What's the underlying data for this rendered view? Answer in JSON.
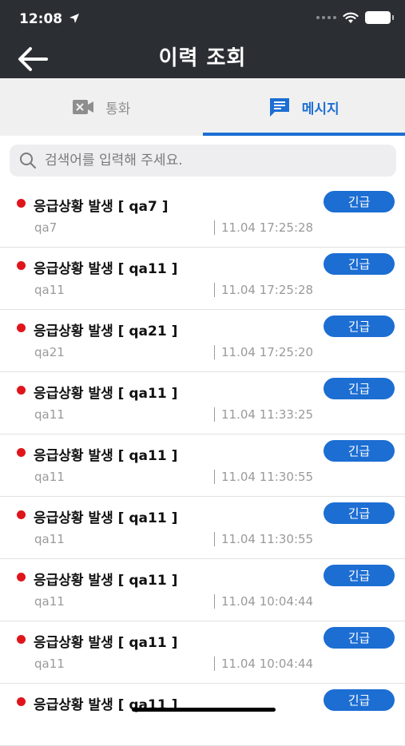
{
  "status_bar": {
    "time": "12:08"
  },
  "header": {
    "title": "이력 조회"
  },
  "tabs": [
    {
      "label": "통화",
      "icon": "video-camera-icon",
      "active": false
    },
    {
      "label": "메시지",
      "icon": "message-icon",
      "active": true
    }
  ],
  "search": {
    "placeholder": "검색어를 입력해 주세요."
  },
  "colors": {
    "header_bg": "#2b2f33",
    "accent": "#1c6ed3",
    "alert_dot": "#e0151b"
  },
  "messages": [
    {
      "title": "응급상황 발생 [ qa7 ]",
      "sender": "qa7",
      "time": "11.04 17:25:28",
      "badge": "긴급"
    },
    {
      "title": "응급상황 발생 [ qa11 ]",
      "sender": "qa11",
      "time": "11.04 17:25:28",
      "badge": "긴급"
    },
    {
      "title": "응급상황 발생 [ qa21 ]",
      "sender": "qa21",
      "time": "11.04 17:25:20",
      "badge": "긴급"
    },
    {
      "title": "응급상황 발생 [ qa11 ]",
      "sender": "qa11",
      "time": "11.04 11:33:25",
      "badge": "긴급"
    },
    {
      "title": "응급상황 발생 [ qa11 ]",
      "sender": "qa11",
      "time": "11.04 11:30:55",
      "badge": "긴급"
    },
    {
      "title": "응급상황 발생 [ qa11 ]",
      "sender": "qa11",
      "time": "11.04 11:30:55",
      "badge": "긴급"
    },
    {
      "title": "응급상황 발생 [ qa11 ]",
      "sender": "qa11",
      "time": "11.04 10:04:44",
      "badge": "긴급"
    },
    {
      "title": "응급상황 발생 [ qa11 ]",
      "sender": "qa11",
      "time": "11.04 10:04:44",
      "badge": "긴급"
    },
    {
      "title": "응급상황 발생 [ qa11 ]",
      "badge": "긴급"
    }
  ]
}
